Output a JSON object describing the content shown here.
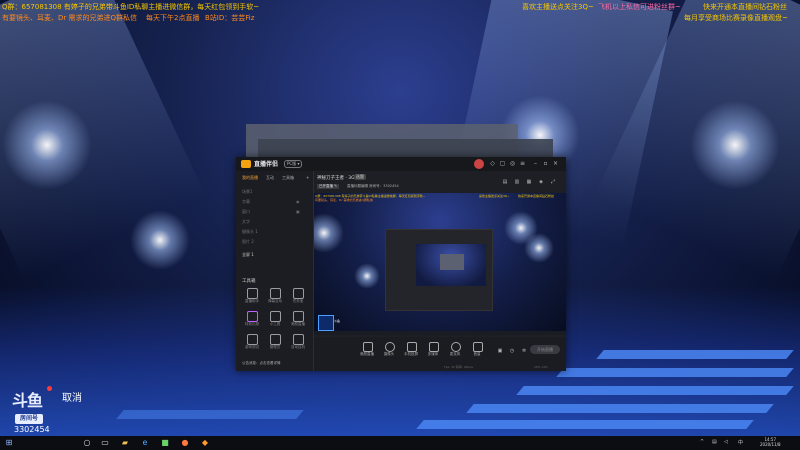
{
  "overlay": {
    "top_left_line1": "Q群：657081308 有婷子的兄弟带斗鱼ID私聊主播进微信群，每天红包领到手软~",
    "top_left_line2": "有要镜头、耳麦、Dr 需求的兄弟进Q群私信",
    "top_left_line2b": "每天下午2点直播",
    "top_left_line2c": "B站ID：芸芸Fiz",
    "top_center_line": "喜欢主播送点关注3Q~",
    "top_center_pink": "飞机以上私信可进粉丝群~",
    "top_right_line1": "快来开通本直播间钻石粉丝",
    "top_right_line2": "每月享受商场比赛录像直播观盘~"
  },
  "app": {
    "name": "直播伴侣",
    "version": "PC版 ▾",
    "sidebar_tabs": [
      "我的直播",
      "互动",
      "工具箱"
    ],
    "sidebar_items": [
      "场景1",
      "字幕",
      "窗口",
      "文字",
      "摄像头 1",
      "图片 2"
    ],
    "sidebar_add": "+",
    "sidebar_scene": "全屏 1",
    "tools_title": "工具箱",
    "tools": [
      "直播助手",
      "弹幕互动",
      "任务宝",
      "特效礼物",
      "小工具",
      "美颜直播",
      "游戏测试",
      "管理员",
      "自动挂机"
    ],
    "sidebar_footer": "公告消息：点击查看详情",
    "content_title": "神秘刀子王者 · 3G",
    "content_badge": "选题",
    "content_sub_btn": "已开直播 ✎",
    "content_sub": "直播标题编辑   房间号：3302454",
    "preview_logo_text": "斗鱼",
    "bottom_buttons": [
      "美颜直播",
      "摄像头",
      "手机投屏",
      "多媒体",
      "麦克风",
      "音量"
    ],
    "live_button": "开始直播",
    "status_left": "Fps: 30  码率: 0kbps",
    "status_right": "CPU 14%"
  },
  "corner": {
    "logo": "斗鱼",
    "badge": "房间号",
    "room_id": "3302454",
    "cancel": "取消"
  },
  "taskbar": {
    "clock_time": "14:57",
    "clock_date": "2020/11/8",
    "tray": "中",
    "icons": [
      "windows-icon",
      "search-icon",
      "taskview-icon",
      "explorer-icon",
      "edge-icon",
      "store-icon",
      "qq-icon",
      "douyu-icon"
    ]
  }
}
